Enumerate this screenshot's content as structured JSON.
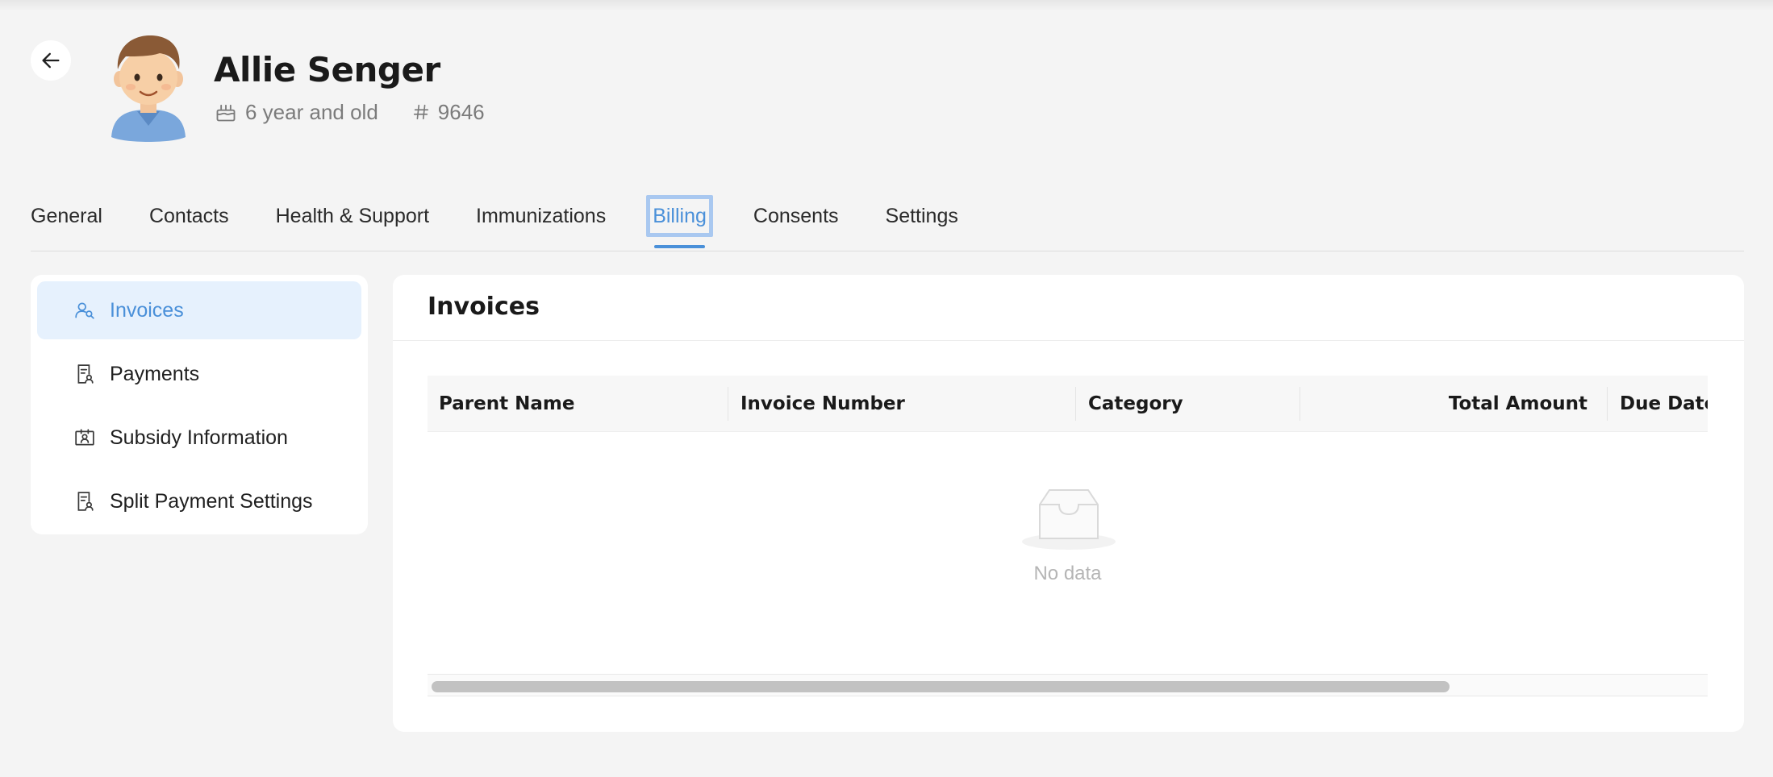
{
  "header": {
    "name": "Allie Senger",
    "age_text": "6 year and old",
    "id_text": "9646"
  },
  "tabs": [
    {
      "label": "General"
    },
    {
      "label": "Contacts"
    },
    {
      "label": "Health & Support"
    },
    {
      "label": "Immunizations"
    },
    {
      "label": "Billing",
      "active": true
    },
    {
      "label": "Consents"
    },
    {
      "label": "Settings"
    }
  ],
  "side_menu": {
    "items": [
      {
        "label": "Invoices",
        "icon": "user-search-icon",
        "active": true
      },
      {
        "label": "Payments",
        "icon": "receipt-user-icon"
      },
      {
        "label": "Subsidy Information",
        "icon": "id-card-icon"
      },
      {
        "label": "Split Payment Settings",
        "icon": "receipt-user-icon"
      }
    ]
  },
  "panel": {
    "title": "Invoices",
    "columns": [
      "Parent Name",
      "Invoice Number",
      "Category",
      "Total Amount",
      "Due Date"
    ],
    "empty_text": "No data"
  },
  "colors": {
    "accent": "#4a90d9",
    "active_bg": "#e6f1fd",
    "page_bg": "#f4f4f4"
  }
}
